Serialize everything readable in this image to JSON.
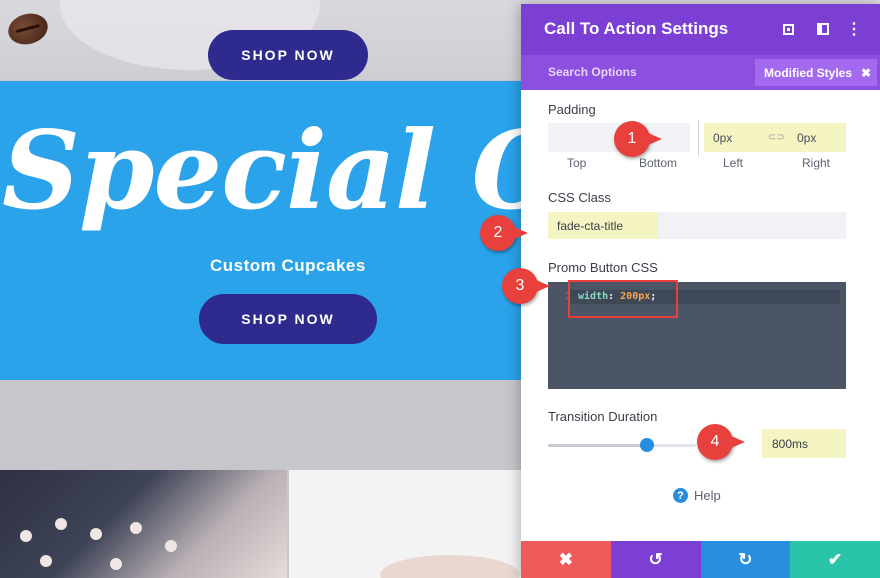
{
  "preview": {
    "top_button": "SHOP NOW",
    "headline": "Special Offe",
    "subheading": "Custom Cupcakes",
    "main_button": "SHOP NOW"
  },
  "panel": {
    "title": "Call To Action Settings",
    "header_icons": [
      "expand-icon",
      "split-view-icon",
      "more-options-icon"
    ],
    "search_label": "Search Options",
    "modified_label": "Modified Styles",
    "modified_close": "✖",
    "padding": {
      "label": "Padding",
      "top_value": "",
      "bottom_value": "",
      "left_value": "0px",
      "link_symbol": "⊂⊃",
      "right_value": "0px",
      "top_label": "Top",
      "bottom_label": "Bottom",
      "left_label": "Left",
      "right_label": "Right"
    },
    "css_class": {
      "label": "CSS Class",
      "value": "fade-cta-title"
    },
    "promo_css": {
      "label": "Promo Button CSS",
      "line_number": "1",
      "property": "width",
      "separator": ": ",
      "value": "200px",
      "terminator": ";"
    },
    "transition": {
      "label": "Transition Duration",
      "value": "800ms",
      "slider_level": 0.67
    },
    "help_label": "Help",
    "footer": {
      "cancel": "✖",
      "undo": "↺",
      "redo": "↻",
      "save": "✔"
    }
  },
  "annotations": {
    "markers": [
      "1",
      "2",
      "3",
      "4"
    ]
  },
  "colors": {
    "panel_header": "#7b3fd4",
    "subbar": "#8c4fe0",
    "hero_blue": "#2aa3ea",
    "button_navy": "#2f2a8e",
    "modified_highlight": "#f5f5c4",
    "marker_red": "#e8403d"
  }
}
